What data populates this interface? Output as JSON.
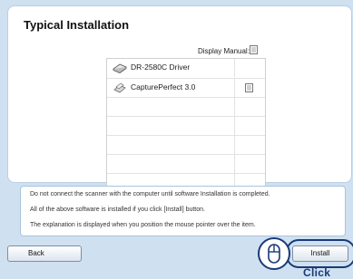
{
  "header": {
    "title": "Typical Installation"
  },
  "manual": {
    "label": "Display Manual:",
    "icon": "document-icon"
  },
  "software_list": {
    "items": [
      {
        "name": "DR-2580C Driver",
        "icon": "scanner-icon",
        "has_manual": false
      },
      {
        "name": "CapturePerfect 3.0",
        "icon": "capture-icon",
        "has_manual": true
      }
    ],
    "empty_rows": 5
  },
  "messages": [
    "Do not connect the scanner with the computer until software Installation is completed.",
    "All of the above software is installed if you click [Install] button.",
    "The explanation is displayed when you position the mouse pointer over the item."
  ],
  "buttons": {
    "back": "Back",
    "install": "Install"
  },
  "annotation": {
    "click_label": "Click",
    "mouse_icon": "mouse-icon"
  },
  "colors": {
    "background": "#cfe1f1",
    "accent": "#1a3a78"
  }
}
